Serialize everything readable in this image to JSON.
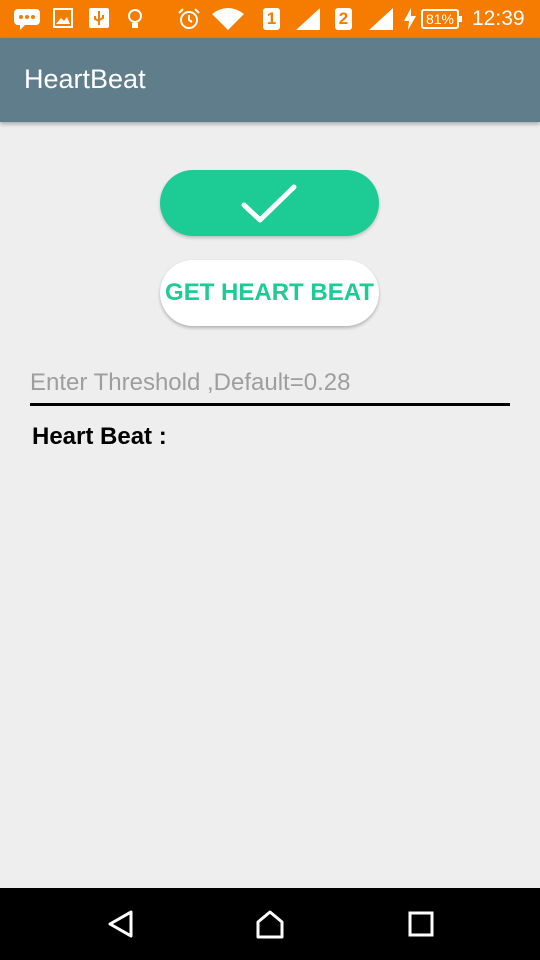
{
  "status_bar": {
    "sim1": "1",
    "sim2": "2",
    "battery": "81%",
    "time": "12:39",
    "icons": [
      "chat-icon",
      "image-icon",
      "usb-icon",
      "lightbulb-icon",
      "alarm-icon",
      "wifi-icon",
      "signal-icon",
      "charging-icon"
    ]
  },
  "app_bar": {
    "title": "HeartBeat"
  },
  "main": {
    "check_icon": "checkmark-icon",
    "get_heart_beat_label": "GET HEART BEAT",
    "threshold_placeholder": "Enter Threshold ,Default=0.28",
    "heart_beat_label": "Heart Beat :"
  },
  "nav_bar": {
    "buttons": [
      "back-icon",
      "home-icon",
      "recents-icon"
    ]
  },
  "colors": {
    "status_bar": "#f57c00",
    "app_bar": "#607d8b",
    "accent": "#1ccc94",
    "background": "#eeeeee"
  }
}
